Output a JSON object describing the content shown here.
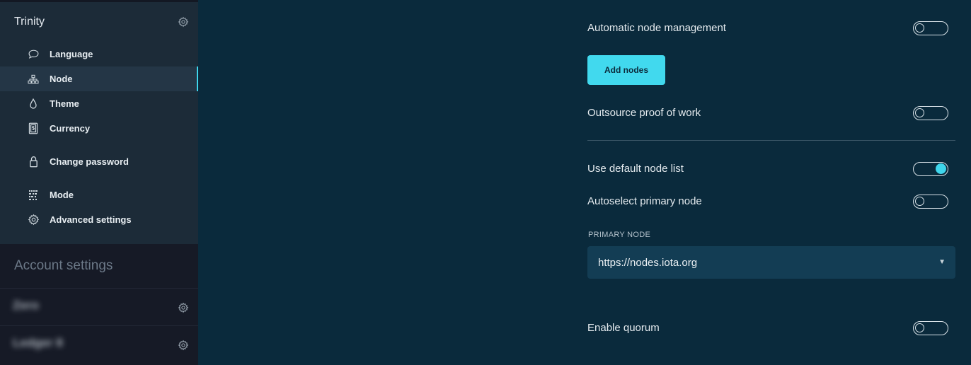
{
  "sidebar": {
    "app_title": "Trinity",
    "items": [
      {
        "label": "Language",
        "icon": "chat-bubble-icon",
        "active": false
      },
      {
        "label": "Node",
        "icon": "network-icon",
        "active": true
      },
      {
        "label": "Theme",
        "icon": "droplet-icon",
        "active": false
      },
      {
        "label": "Currency",
        "icon": "currency-note-icon",
        "active": false
      },
      {
        "label": "Change password",
        "icon": "lock-icon",
        "active": false
      },
      {
        "label": "Mode",
        "icon": "mode-icon",
        "active": false
      },
      {
        "label": "Advanced settings",
        "icon": "gear-icon",
        "active": false
      }
    ],
    "account_settings_title": "Account settings",
    "accounts": [
      {
        "name": "Zero"
      },
      {
        "name": "Ledger 8"
      }
    ]
  },
  "main": {
    "automatic_node_management": {
      "label": "Automatic node management",
      "enabled": false
    },
    "add_nodes_label": "Add nodes",
    "outsource_pow": {
      "label": "Outsource proof of work",
      "enabled": false
    },
    "use_default_node_list": {
      "label": "Use default node list",
      "enabled": true
    },
    "autoselect_primary_node": {
      "label": "Autoselect primary node",
      "enabled": false
    },
    "primary_node": {
      "label": "PRIMARY NODE",
      "value": "https://nodes.iota.org"
    },
    "enable_quorum": {
      "label": "Enable quorum",
      "enabled": false
    }
  },
  "colors": {
    "accent": "#3fd6ec",
    "main_background": "#0a2a3c",
    "sidebar_background": "#1c2b38"
  }
}
